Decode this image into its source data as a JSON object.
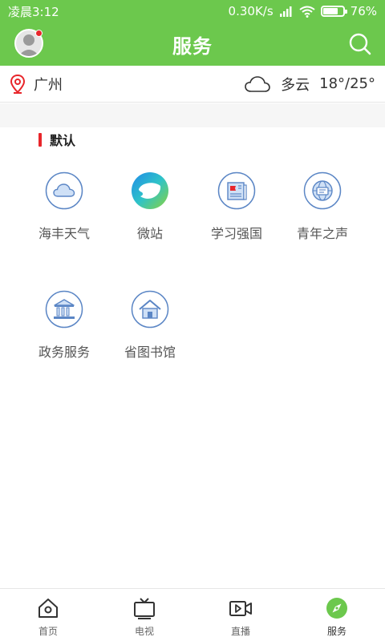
{
  "status_bar": {
    "time": "凌晨3:12",
    "network_speed": "0.30K/s",
    "battery": "76%",
    "battery_level": 0.76
  },
  "header": {
    "title": "服务"
  },
  "location": {
    "city": "广州",
    "weather": "多云",
    "temperature": "18°/25°"
  },
  "section": {
    "title": "默认"
  },
  "services": [
    {
      "label": "海丰天气",
      "icon": "cloud-icon"
    },
    {
      "label": "微站",
      "icon": "weizhan-logo"
    },
    {
      "label": "学习强国",
      "icon": "newspaper-flag-icon"
    },
    {
      "label": "青年之声",
      "icon": "globe-message-icon"
    },
    {
      "label": "政务服务",
      "icon": "government-building-icon"
    },
    {
      "label": "省图书馆",
      "icon": "library-house-icon"
    }
  ],
  "nav": [
    {
      "label": "首页",
      "icon": "home-icon"
    },
    {
      "label": "电视",
      "icon": "tv-icon"
    },
    {
      "label": "直播",
      "icon": "live-video-icon"
    },
    {
      "label": "服务",
      "icon": "compass-icon",
      "active": true
    }
  ],
  "colors": {
    "brand_green": "#6cc84d",
    "accent_red": "#e8262b",
    "icon_blue": "#5b86c5"
  }
}
